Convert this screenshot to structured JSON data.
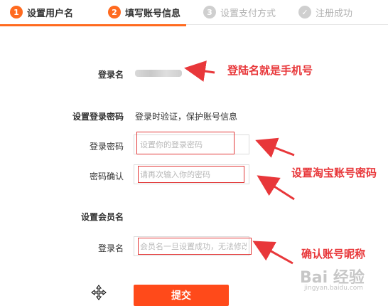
{
  "steps": [
    {
      "num": "1",
      "label": "设置用户名",
      "state": "done"
    },
    {
      "num": "2",
      "label": "填写账号信息",
      "state": "active"
    },
    {
      "num": "3",
      "label": "设置支付方式",
      "state": "todo"
    },
    {
      "num": "✓",
      "label": "注册成功",
      "state": "todo"
    }
  ],
  "form": {
    "login_name_label": "登录名",
    "login_password_section": "设置登录密码",
    "login_password_desc": "登录时验证，保护账号信息",
    "password_label": "登录密码",
    "password_placeholder": "设置你的登录密码",
    "confirm_label": "密码确认",
    "confirm_placeholder": "请再次输入你的密码",
    "member_section": "设置会员名",
    "member_label": "登录名",
    "member_placeholder": "会员名一旦设置成功，无法修改",
    "submit_label": "提交"
  },
  "annotations": {
    "note1": "登陆名就是手机号",
    "note2": "设置淘宝账号密码",
    "note3": "确认账号昵称"
  },
  "watermark": {
    "logo": "Bai 经验",
    "url": "jingyan.baidu.com"
  },
  "colors": {
    "accent": "#ff6a1f",
    "submit": "#ff4a1a",
    "annotation": "#e8373a"
  }
}
